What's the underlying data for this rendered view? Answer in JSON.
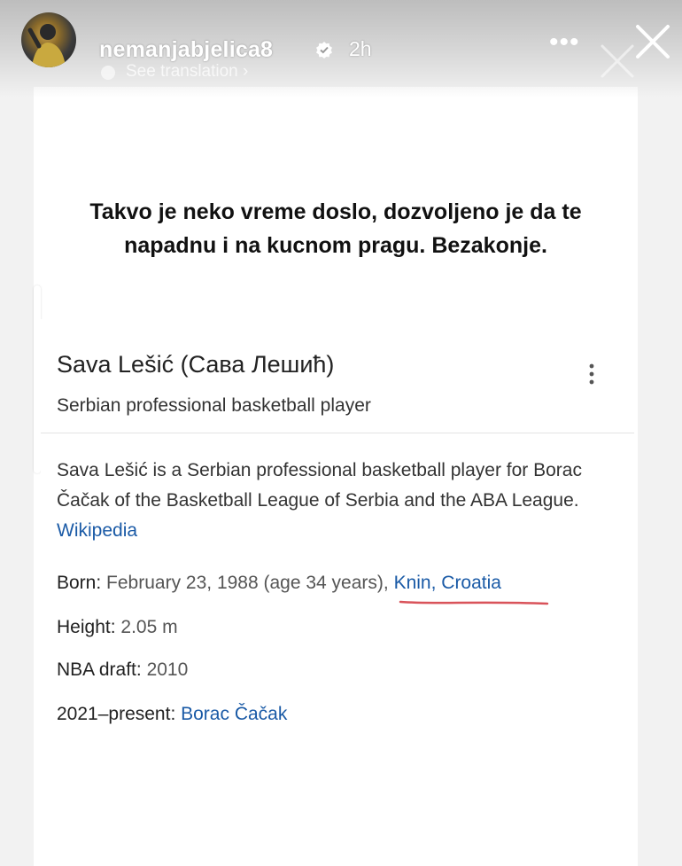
{
  "story": {
    "username": "nemanjabjelica8",
    "time": "2h",
    "translation": "See translation ›",
    "more": "•••",
    "close_icon": "close-icon",
    "caption": "Takvo je neko vreme doslo, dozvoljeno je da te napadnu i na kucnom pragu. Bezakonje."
  },
  "card": {
    "name": "Sava Lešić (Сава Лешић)",
    "subtitle": "Serbian professional basketball player",
    "description": "Sava Lešić is a Serbian professional basketball player for Borac Čačak of the Basketball League of Serbia and the ABA League.",
    "description_link": "Wikipedia",
    "born_label": "Born:",
    "born_value": "February 23, 1988 (age 34 years),",
    "born_place": "Knin, Croatia",
    "height_label": "Height:",
    "height_value": "2.05 m",
    "draft_label": "NBA draft:",
    "draft_value": "2010",
    "team_label": "2021–present:",
    "team_value": "Borac Čačak"
  },
  "colors": {
    "link": "#1a5aa6",
    "underline": "#d9535a",
    "verified": "#ffffff"
  }
}
